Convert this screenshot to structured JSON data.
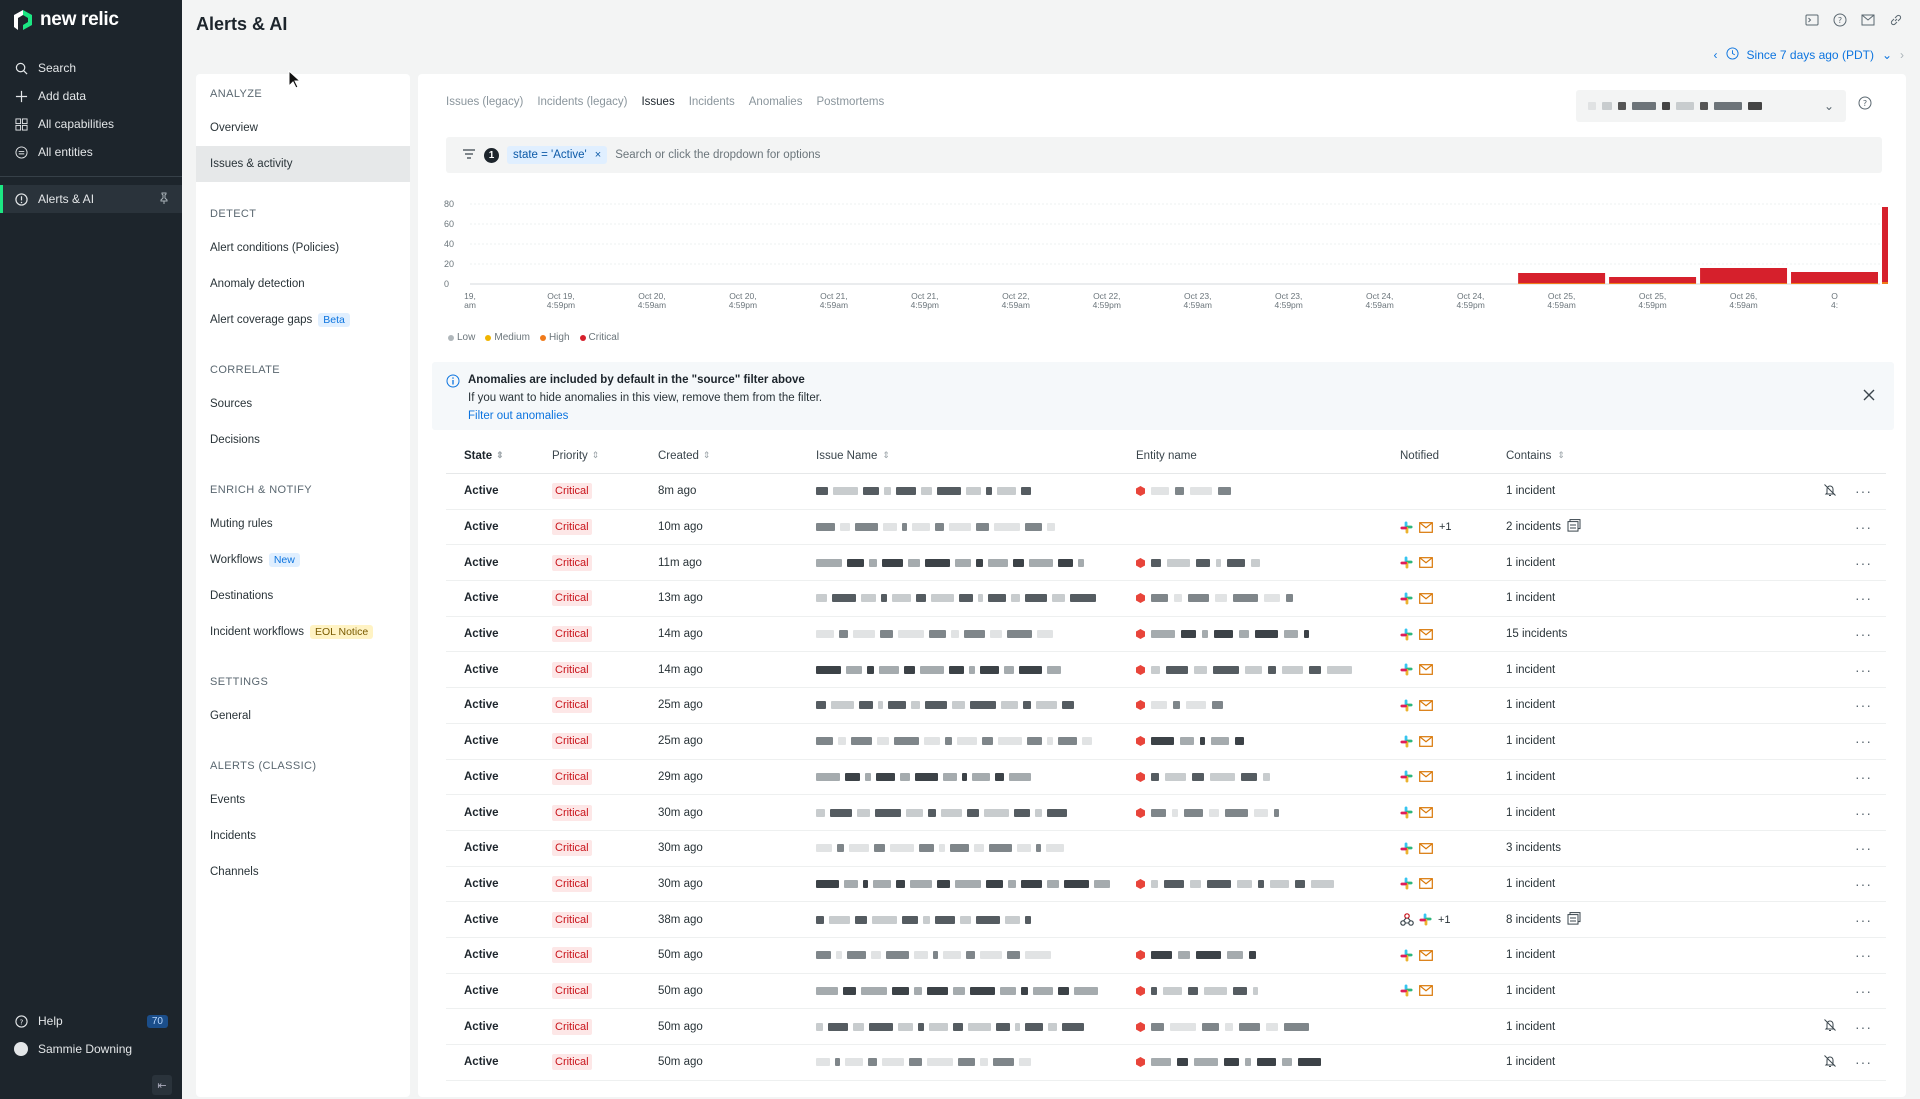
{
  "app": {
    "brand": "new relic",
    "page_title": "Alerts & AI"
  },
  "leftnav": {
    "items": [
      {
        "label": "Search",
        "icon": "search-icon"
      },
      {
        "label": "Add data",
        "icon": "plus-icon"
      },
      {
        "label": "All capabilities",
        "icon": "grid-icon"
      },
      {
        "label": "All entities",
        "icon": "entities-icon"
      }
    ],
    "active_item": {
      "label": "Alerts & AI",
      "icon": "alert-icon"
    },
    "bottom": {
      "help_label": "Help",
      "help_badge": "70",
      "user_name": "Sammie Downing"
    }
  },
  "timepicker": {
    "label": "Since 7 days ago (PDT)"
  },
  "secnav": {
    "sections": [
      {
        "heading": "ANALYZE",
        "items": [
          {
            "label": "Overview"
          },
          {
            "label": "Issues & activity",
            "selected": true
          }
        ]
      },
      {
        "heading": "DETECT",
        "items": [
          {
            "label": "Alert conditions (Policies)"
          },
          {
            "label": "Anomaly detection"
          },
          {
            "label": "Alert coverage gaps",
            "tag": "Beta",
            "tag_type": "beta"
          }
        ]
      },
      {
        "heading": "CORRELATE",
        "items": [
          {
            "label": "Sources"
          },
          {
            "label": "Decisions"
          }
        ]
      },
      {
        "heading": "ENRICH & NOTIFY",
        "items": [
          {
            "label": "Muting rules"
          },
          {
            "label": "Workflows",
            "tag": "New",
            "tag_type": "new"
          },
          {
            "label": "Destinations"
          },
          {
            "label": "Incident workflows",
            "tag": "EOL Notice",
            "tag_type": "eol"
          }
        ]
      },
      {
        "heading": "SETTINGS",
        "items": [
          {
            "label": "General"
          }
        ]
      },
      {
        "heading": "ALERTS (CLASSIC)",
        "items": [
          {
            "label": "Events"
          },
          {
            "label": "Incidents"
          },
          {
            "label": "Channels"
          }
        ]
      }
    ]
  },
  "tabs": [
    {
      "label": "Issues (legacy)"
    },
    {
      "label": "Incidents (legacy)"
    },
    {
      "label": "Issues",
      "active": true
    },
    {
      "label": "Incidents"
    },
    {
      "label": "Anomalies"
    },
    {
      "label": "Postmortems"
    }
  ],
  "filter": {
    "count": "1",
    "chip": "state = 'Active'",
    "chip_remove": "×",
    "placeholder": "Search or click the dropdown for options"
  },
  "chart_data": {
    "type": "bar",
    "y_ticks": [
      "80",
      "60",
      "40",
      "20",
      "0"
    ],
    "ylim": [
      0,
      80
    ],
    "x_ticks": [
      {
        "line1": "19,",
        "line2": "am"
      },
      {
        "line1": "Oct 19,",
        "line2": "4:59pm"
      },
      {
        "line1": "Oct 20,",
        "line2": "4:59am"
      },
      {
        "line1": "Oct 20,",
        "line2": "4:59pm"
      },
      {
        "line1": "Oct 21,",
        "line2": "4:59am"
      },
      {
        "line1": "Oct 21,",
        "line2": "4:59pm"
      },
      {
        "line1": "Oct 22,",
        "line2": "4:59am"
      },
      {
        "line1": "Oct 22,",
        "line2": "4:59pm"
      },
      {
        "line1": "Oct 23,",
        "line2": "4:59am"
      },
      {
        "line1": "Oct 23,",
        "line2": "4:59pm"
      },
      {
        "line1": "Oct 24,",
        "line2": "4:59am"
      },
      {
        "line1": "Oct 24,",
        "line2": "4:59pm"
      },
      {
        "line1": "Oct 25,",
        "line2": "4:59am"
      },
      {
        "line1": "Oct 25,",
        "line2": "4:59pm"
      },
      {
        "line1": "Oct 26,",
        "line2": "4:59am"
      },
      {
        "line1": "O",
        "line2": "4:"
      }
    ],
    "bars": [
      {
        "bucket": 12,
        "critical": 10,
        "high": 1
      },
      {
        "bucket": 13,
        "critical": 6,
        "high": 1
      },
      {
        "bucket": 14,
        "critical": 15,
        "high": 1
      },
      {
        "bucket": 15,
        "critical": 11,
        "high": 1
      },
      {
        "bucket": 16,
        "critical": 75,
        "high": 2
      }
    ],
    "legend": [
      {
        "name": "Low",
        "color": "#b0b7bb"
      },
      {
        "name": "Medium",
        "color": "#f0b400"
      },
      {
        "name": "High",
        "color": "#f07a1a"
      },
      {
        "name": "Critical",
        "color": "#d6202c"
      }
    ]
  },
  "banner": {
    "title": "Anomalies are included by default in the \"source\" filter above",
    "body": "If you want to hide anomalies in this view, remove them from the filter.",
    "link": "Filter out anomalies"
  },
  "table": {
    "columns": [
      "State",
      "Priority",
      "Created",
      "Issue Name",
      "Entity name",
      "Notified",
      "Contains"
    ],
    "rows": [
      {
        "state": "Active",
        "priority": "Critical",
        "created": "8m ago",
        "entity": true,
        "notified": [],
        "contains": "1 incident",
        "muted": true
      },
      {
        "state": "Active",
        "priority": "Critical",
        "created": "10m ago",
        "entity": false,
        "notified": [
          "slack",
          "mail",
          "+1"
        ],
        "contains": "2 incidents",
        "stack": true
      },
      {
        "state": "Active",
        "priority": "Critical",
        "created": "11m ago",
        "entity": true,
        "notified": [
          "slack",
          "mail"
        ],
        "contains": "1 incident"
      },
      {
        "state": "Active",
        "priority": "Critical",
        "created": "13m ago",
        "entity": true,
        "notified": [
          "slack",
          "mail"
        ],
        "contains": "1 incident"
      },
      {
        "state": "Active",
        "priority": "Critical",
        "created": "14m ago",
        "entity": true,
        "notified": [
          "slack",
          "mail"
        ],
        "contains": "15 incidents"
      },
      {
        "state": "Active",
        "priority": "Critical",
        "created": "14m ago",
        "entity": true,
        "notified": [
          "slack",
          "mail"
        ],
        "contains": "1 incident"
      },
      {
        "state": "Active",
        "priority": "Critical",
        "created": "25m ago",
        "entity": true,
        "notified": [
          "slack",
          "mail"
        ],
        "contains": "1 incident"
      },
      {
        "state": "Active",
        "priority": "Critical",
        "created": "25m ago",
        "entity": true,
        "notified": [
          "slack",
          "mail"
        ],
        "contains": "1 incident"
      },
      {
        "state": "Active",
        "priority": "Critical",
        "created": "29m ago",
        "entity": true,
        "notified": [
          "slack",
          "mail"
        ],
        "contains": "1 incident"
      },
      {
        "state": "Active",
        "priority": "Critical",
        "created": "30m ago",
        "entity": true,
        "notified": [
          "slack",
          "mail"
        ],
        "contains": "1 incident"
      },
      {
        "state": "Active",
        "priority": "Critical",
        "created": "30m ago",
        "entity": false,
        "notified": [
          "slack",
          "mail"
        ],
        "contains": "3 incidents"
      },
      {
        "state": "Active",
        "priority": "Critical",
        "created": "30m ago",
        "entity": true,
        "notified": [
          "slack",
          "mail"
        ],
        "contains": "1 incident"
      },
      {
        "state": "Active",
        "priority": "Critical",
        "created": "38m ago",
        "entity": false,
        "notified": [
          "webhook",
          "slack",
          "+1"
        ],
        "contains": "8 incidents",
        "stack": true
      },
      {
        "state": "Active",
        "priority": "Critical",
        "created": "50m ago",
        "entity": true,
        "notified": [
          "slack",
          "mail"
        ],
        "contains": "1 incident"
      },
      {
        "state": "Active",
        "priority": "Critical",
        "created": "50m ago",
        "entity": true,
        "notified": [
          "slack",
          "mail"
        ],
        "contains": "1 incident"
      },
      {
        "state": "Active",
        "priority": "Critical",
        "created": "50m ago",
        "entity": true,
        "notified": [],
        "contains": "1 incident",
        "muted": true
      },
      {
        "state": "Active",
        "priority": "Critical",
        "created": "50m ago",
        "entity": true,
        "notified": [],
        "contains": "1 incident",
        "muted": true
      }
    ]
  },
  "colors": {
    "critical": "#d6202c",
    "accent": "#0c74df",
    "nav_bg": "#1d252c",
    "brand_green": "#1ce783"
  }
}
